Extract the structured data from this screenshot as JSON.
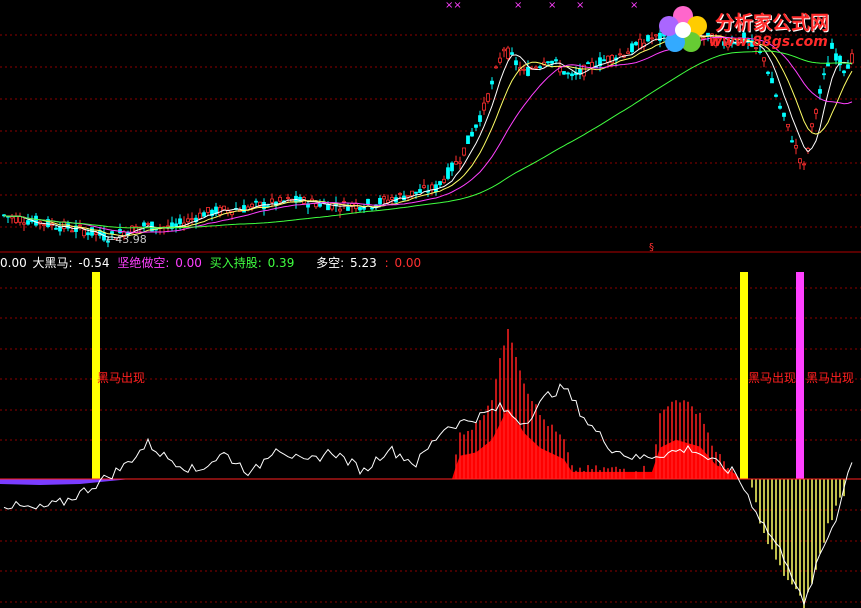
{
  "watermark": {
    "title": "分析家公式网",
    "url": "www.88gs.com"
  },
  "top_panel": {
    "low_price_label": "43.98",
    "top_marks": [
      "××",
      "×",
      "×",
      "×",
      "×"
    ],
    "s_mark": "§"
  },
  "legend": {
    "first_value": "0.00",
    "items": [
      {
        "name": "大黑马:",
        "value": "-0.54",
        "color": "#ffffff",
        "value_color": "#ffffff"
      },
      {
        "name": "坚绝做空:",
        "value": "0.00",
        "color": "#ff40ff",
        "value_color": "#ff40ff"
      },
      {
        "name": "买入持股:",
        "value": "0.39",
        "color": "#40ff40",
        "value_color": "#40ff40"
      },
      {
        "name": "多空:",
        "value": "5.23",
        "color": "#ffffff",
        "value_color": "#ffffff"
      },
      {
        "name": ":",
        "value": "0.00",
        "color": "#ff3030",
        "value_color": "#ff3030"
      }
    ]
  },
  "signals": [
    {
      "label": "黑马出现",
      "x_index": 23,
      "color": "#ffff00"
    },
    {
      "label": "黑马出现",
      "x_index": 185,
      "color": "#ffff00"
    },
    {
      "label": "黑马出现",
      "x_index": 199,
      "color": "#ff40ff"
    }
  ],
  "colors": {
    "up": "#ff3030",
    "down": "#00ffff",
    "ma5": "#ffffff",
    "ma10": "#ffff66",
    "ma20": "#ff40ff",
    "ma60": "#40ff40",
    "grid": "#8b0000",
    "divider": "#b00000",
    "osc_line": "#ffffff",
    "pos_bar": "#ff2020",
    "neg_bar": "#ffff66",
    "area": "#ff0000"
  },
  "chart_data": {
    "type": "candlestick",
    "title": "",
    "price_low_marker": 43.98,
    "bars": 213,
    "price_range": [
      42,
      90
    ],
    "osc_range": [
      -52,
      60
    ],
    "price_keypoints": [
      [
        0,
        48.5
      ],
      [
        10,
        47
      ],
      [
        20,
        45.5
      ],
      [
        26,
        44.2
      ],
      [
        35,
        46.5
      ],
      [
        42,
        46
      ],
      [
        50,
        49
      ],
      [
        60,
        50
      ],
      [
        72,
        51.5
      ],
      [
        84,
        50.5
      ],
      [
        92,
        50.8
      ],
      [
        100,
        52.5
      ],
      [
        108,
        54
      ],
      [
        114,
        60
      ],
      [
        120,
        70
      ],
      [
        125,
        82
      ],
      [
        130,
        77
      ],
      [
        136,
        80
      ],
      [
        142,
        76
      ],
      [
        148,
        79
      ],
      [
        155,
        81
      ],
      [
        162,
        84
      ],
      [
        166,
        84
      ],
      [
        176,
        84
      ],
      [
        180,
        83
      ],
      [
        185,
        84
      ],
      [
        190,
        80
      ],
      [
        194,
        70
      ],
      [
        198,
        62
      ],
      [
        200,
        58
      ],
      [
        203,
        70
      ],
      [
        207,
        82
      ],
      [
        210,
        78
      ],
      [
        212,
        80
      ]
    ],
    "osc_keypoints": [
      [
        0,
        -10
      ],
      [
        8,
        -12
      ],
      [
        15,
        -9
      ],
      [
        22,
        -3
      ],
      [
        30,
        5
      ],
      [
        36,
        14
      ],
      [
        40,
        9
      ],
      [
        48,
        3
      ],
      [
        55,
        10
      ],
      [
        62,
        2
      ],
      [
        68,
        13
      ],
      [
        75,
        6
      ],
      [
        82,
        11
      ],
      [
        90,
        3
      ],
      [
        96,
        12
      ],
      [
        103,
        6
      ],
      [
        110,
        20
      ],
      [
        118,
        24
      ],
      [
        124,
        28
      ],
      [
        130,
        22
      ],
      [
        136,
        33
      ],
      [
        140,
        36
      ],
      [
        146,
        22
      ],
      [
        152,
        12
      ],
      [
        158,
        8
      ],
      [
        165,
        10
      ],
      [
        172,
        12
      ],
      [
        178,
        6
      ],
      [
        183,
        2
      ],
      [
        190,
        -18
      ],
      [
        196,
        -33
      ],
      [
        200,
        -50
      ],
      [
        204,
        -30
      ],
      [
        208,
        -15
      ],
      [
        212,
        8
      ]
    ],
    "hist_keypoints": [
      [
        0,
        0
      ],
      [
        112,
        0
      ],
      [
        114,
        18
      ],
      [
        118,
        21
      ],
      [
        122,
        32
      ],
      [
        126,
        60
      ],
      [
        130,
        38
      ],
      [
        134,
        25
      ],
      [
        140,
        15
      ],
      [
        142,
        4
      ],
      [
        162,
        4
      ],
      [
        164,
        25
      ],
      [
        168,
        32
      ],
      [
        174,
        26
      ],
      [
        178,
        10
      ],
      [
        182,
        4
      ],
      [
        184,
        0
      ],
      [
        185,
        0
      ],
      [
        187,
        -4
      ],
      [
        190,
        -22
      ],
      [
        194,
        -35
      ],
      [
        198,
        -44
      ],
      [
        200,
        -50
      ],
      [
        203,
        -36
      ],
      [
        206,
        -18
      ],
      [
        209,
        -8
      ],
      [
        212,
        0
      ]
    ]
  }
}
